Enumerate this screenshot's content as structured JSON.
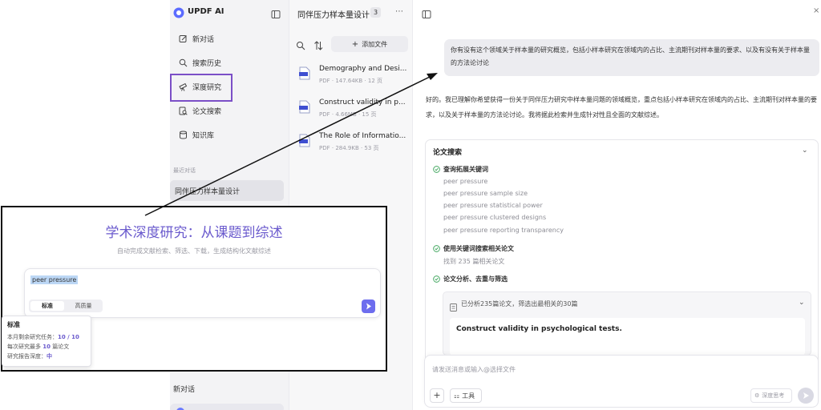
{
  "app": {
    "name": "UPDF AI"
  },
  "sidebar": {
    "items": [
      {
        "label": "新对话",
        "icon": "edit-icon"
      },
      {
        "label": "搜索历史",
        "icon": "search-icon"
      },
      {
        "label": "深度研究",
        "icon": "telescope-icon"
      },
      {
        "label": "论文搜索",
        "icon": "paper-search-icon"
      },
      {
        "label": "知识库",
        "icon": "database-icon"
      }
    ],
    "recent_header": "最近对话",
    "recent_items": [
      "同伴压力样本量设计"
    ],
    "bottom_item": "新对话"
  },
  "filepanel": {
    "title": "同伴压力样本量设计",
    "count": "3",
    "add_label": "添加文件",
    "files": [
      {
        "name": "Demography and Desi...",
        "meta": "PDF · 147.64KB · 12 页"
      },
      {
        "name": "Construct validity in p...",
        "meta": "PDF · 4.66MB · 15 页"
      },
      {
        "name": "The Role of Informatio...",
        "meta": "PDF · 284.9KB · 53 页"
      }
    ]
  },
  "chat": {
    "user_message": "你有没有这个领域关于样本量的研究概览，包括小样本研究在领域内的占比、主流期刊对样本量的要求、以及有没有关于样本量的方法论讨论",
    "ai_reply": "好的。我已理解你希望获得一份关于同伴压力研究中样本量问题的领域概览，重点包括小样本研究在领域内的占比、主流期刊对样本量的要求，以及关于样本量的方法论讨论。我将据此检索并生成针对性且全面的文献综述。",
    "search_card": {
      "title": "论文搜索",
      "steps": [
        {
          "label": "查询拓展关键词"
        },
        {
          "label": "使用关键词搜索相关论文",
          "detail": "找到 235 篇相关论文"
        },
        {
          "label": "论文分析、去重与筛选"
        }
      ],
      "keywords": [
        "peer pressure",
        "peer pressure sample size",
        "peer pressure statistical power",
        "peer pressure clustered designs",
        "peer pressure reporting transparency"
      ],
      "analysis_summary": "已分析235篇论文，筛选出最相关的30篇",
      "top_paper": "Construct validity in psychological tests."
    },
    "input_placeholder": "请发送消息或输入@选择文件",
    "tools_label": "工具",
    "deep_think_label": "深度思考"
  },
  "overlay": {
    "title": "学术深度研究：从课题到综述",
    "subtitle": "自动完成文献检索、筛选、下载，生成结构化文献综述",
    "query": "peer pressure",
    "mode_standard": "标准",
    "mode_quality": "高质量",
    "tooltip": {
      "title": "标准",
      "line1_label": "本月剩余研究任务：",
      "line1_value": "10 / 10",
      "line2_prefix": "每次研究最多",
      "line2_value": "10",
      "line2_suffix": "篇论文",
      "line3_label": "研究报告深度：",
      "line3_value": "中"
    }
  },
  "colors": {
    "highlight": "#7b4fc7",
    "accent": "#6a5acd",
    "check_green": "#3ea55c"
  }
}
